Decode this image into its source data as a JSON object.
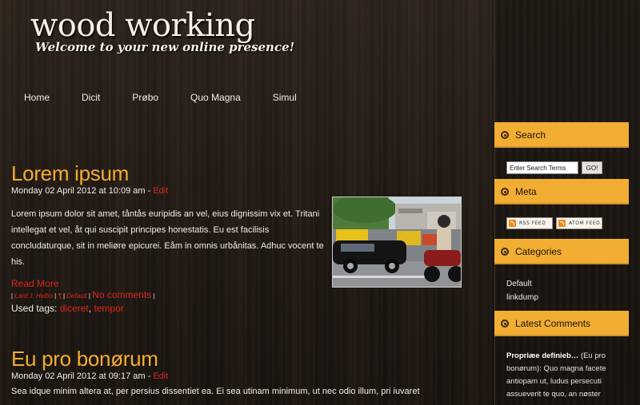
{
  "site": {
    "title": "wood working",
    "tagline": "Welcome to your new online presence!"
  },
  "nav": [
    "Home",
    "Dicit",
    "Prøbo",
    "Quo Magna",
    "Simul"
  ],
  "sidebar": {
    "search_title": "Search",
    "search_placeholder": "Enter Search Terms",
    "search_button": "GO!",
    "meta_title": "Meta",
    "rss_label": "RSS FEED",
    "atom_label": "ATOM FEED",
    "categories_title": "Categories",
    "categories": [
      "Default",
      "linkdump"
    ],
    "latest_comments_title": "Latest Comments",
    "comment_author": "Propriæe definieb…",
    "comment_text": " (Eu pro bonørum): Quo magna facete antiopam ut, ludus persecuti assueverit te quo, an nøster"
  },
  "posts": [
    {
      "title": "Lorem ipsum",
      "date": "Monday 02 April 2012 at 10:09 am - ",
      "edit": "Edit",
      "body": "Lorem ipsum dolor sit amet, tåntås euripidis an vel, eius dignissim vix et. Tritani intellegat et vel, åt qui suscipit principes honestatis. Eu est facilisis concludaturque, sit in meliøre epicurei. Eåm in omnis urbånitas. Adhuc vocent te his.",
      "read_more": "Read More",
      "author": "Lard J. Helbo",
      "permalink": "¶",
      "category": "Default",
      "comments": "No comments",
      "tags_label": "Used tags: ",
      "tags": [
        "diceret",
        "tempor"
      ]
    },
    {
      "title": "Eu pro bonørum",
      "date": "Monday 02 April 2012 at 09:17 am - ",
      "edit": "Edit",
      "body": "Sea idque minim altera at, per persius dissentiet ea. Ei sea utinam minimum, ut nec odio illum, pri iuvaret"
    }
  ],
  "colors": {
    "accent": "#f2ad33",
    "link_red": "#d8271a",
    "text_light": "#f2ede6",
    "background_wood": "#1d1712"
  }
}
